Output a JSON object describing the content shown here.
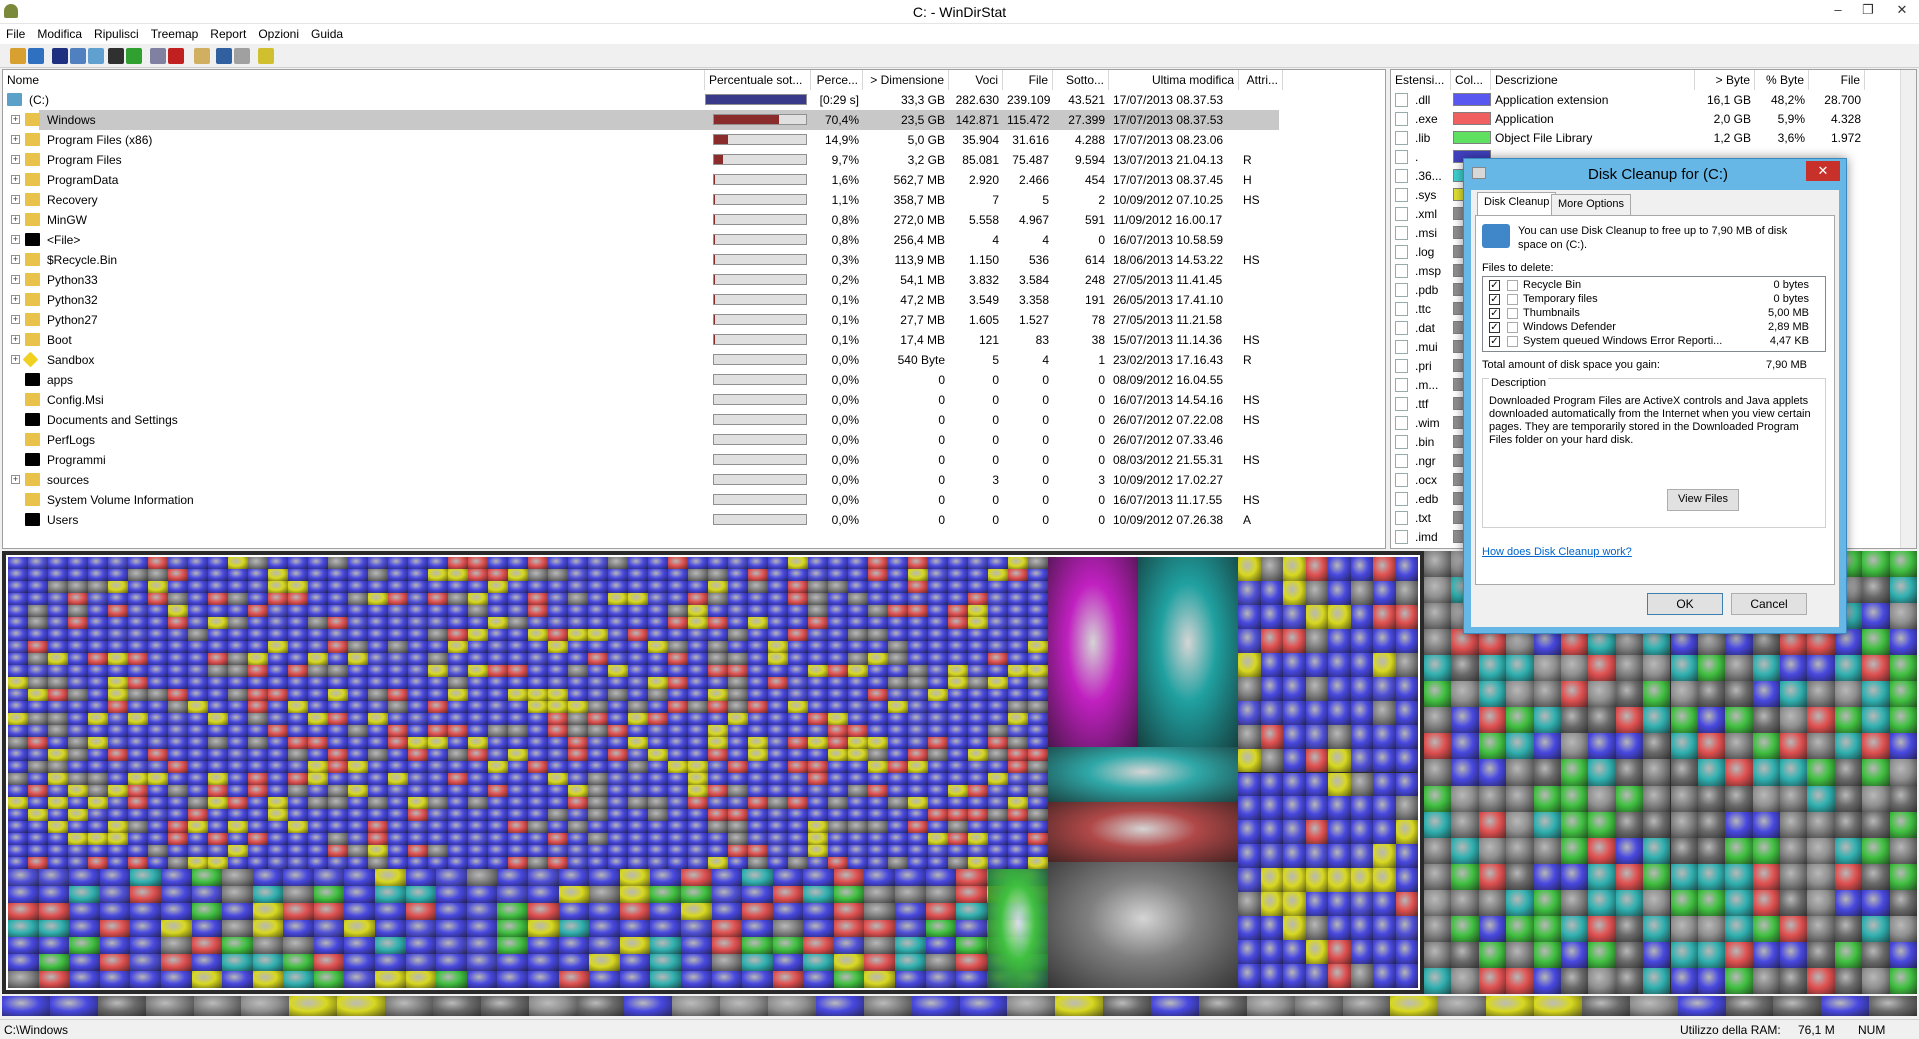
{
  "window": {
    "title": "C: - WinDirStat",
    "controls": {
      "minimize": "–",
      "maximize": "❐",
      "close": "✕"
    }
  },
  "menu": [
    "File",
    "Modifica",
    "Ripulisci",
    "Treemap",
    "Report",
    "Opzioni",
    "Guida"
  ],
  "toolbar": [
    "open-icon",
    "refresh-icon",
    "play-icon",
    "copy-icon",
    "explorer-icon",
    "console-icon",
    "refresh-selected-icon",
    "recycle-icon",
    "delete-icon",
    "new-folder-icon",
    "zoom-in-icon",
    "zoom-out-icon",
    "help-icon"
  ],
  "tree": {
    "headers": [
      "Nome",
      "Percentuale sot...",
      "Perce...",
      "> Dimensione",
      "Voci",
      "File",
      "Sotto...",
      "Ultima modifica",
      "Attri..."
    ],
    "rows": [
      {
        "name": "(C:)",
        "pct": "[0:29 s]",
        "size": "33,3 GB",
        "items": "282.630",
        "files": "239.109",
        "subdirs": "43.521",
        "modified": "17/07/2013 08.37.53",
        "attr": "",
        "fill": 100,
        "type": "drive"
      },
      {
        "name": "Windows",
        "pct": "70,4%",
        "size": "23,5 GB",
        "items": "142.871",
        "files": "115.472",
        "subdirs": "27.399",
        "modified": "17/07/2013 08.37.53",
        "attr": "",
        "fill": 70.4,
        "type": "folder",
        "sel": true
      },
      {
        "name": "Program Files (x86)",
        "pct": "14,9%",
        "size": "5,0 GB",
        "items": "35.904",
        "files": "31.616",
        "subdirs": "4.288",
        "modified": "17/07/2013 08.23.06",
        "attr": "",
        "fill": 14.9,
        "type": "folder"
      },
      {
        "name": "Program Files",
        "pct": "9,7%",
        "size": "3,2 GB",
        "items": "85.081",
        "files": "75.487",
        "subdirs": "9.594",
        "modified": "13/07/2013 21.04.13",
        "attr": "R",
        "fill": 9.7,
        "type": "folder"
      },
      {
        "name": "ProgramData",
        "pct": "1,6%",
        "size": "562,7 MB",
        "items": "2.920",
        "files": "2.466",
        "subdirs": "454",
        "modified": "17/07/2013 08.37.45",
        "attr": "H",
        "fill": 1.6,
        "type": "folder"
      },
      {
        "name": "Recovery",
        "pct": "1,1%",
        "size": "358,7 MB",
        "items": "7",
        "files": "5",
        "subdirs": "2",
        "modified": "10/09/2012 07.10.25",
        "attr": "HS",
        "fill": 1.1,
        "type": "folder"
      },
      {
        "name": "MinGW",
        "pct": "0,8%",
        "size": "272,0 MB",
        "items": "5.558",
        "files": "4.967",
        "subdirs": "591",
        "modified": "11/09/2012 16.00.17",
        "attr": "",
        "fill": 0.8,
        "type": "folder"
      },
      {
        "name": "<File>",
        "pct": "0,8%",
        "size": "256,4 MB",
        "items": "4",
        "files": "4",
        "subdirs": "0",
        "modified": "16/07/2013 10.58.59",
        "attr": "",
        "fill": 0.8,
        "type": "black"
      },
      {
        "name": "$Recycle.Bin",
        "pct": "0,3%",
        "size": "113,9 MB",
        "items": "1.150",
        "files": "536",
        "subdirs": "614",
        "modified": "18/06/2013 14.53.22",
        "attr": "HS",
        "fill": 0.3,
        "type": "folder"
      },
      {
        "name": "Python33",
        "pct": "0,2%",
        "size": "54,1 MB",
        "items": "3.832",
        "files": "3.584",
        "subdirs": "248",
        "modified": "27/05/2013 11.41.45",
        "attr": "",
        "fill": 0.2,
        "type": "folder"
      },
      {
        "name": "Python32",
        "pct": "0,1%",
        "size": "47,2 MB",
        "items": "3.549",
        "files": "3.358",
        "subdirs": "191",
        "modified": "26/05/2013 17.41.10",
        "attr": "",
        "fill": 0.1,
        "type": "folder"
      },
      {
        "name": "Python27",
        "pct": "0,1%",
        "size": "27,7 MB",
        "items": "1.605",
        "files": "1.527",
        "subdirs": "78",
        "modified": "27/05/2013 11.21.58",
        "attr": "",
        "fill": 0.1,
        "type": "folder"
      },
      {
        "name": "Boot",
        "pct": "0,1%",
        "size": "17,4 MB",
        "items": "121",
        "files": "83",
        "subdirs": "38",
        "modified": "15/07/2013 11.14.36",
        "attr": "HS",
        "fill": 0.1,
        "type": "folder"
      },
      {
        "name": "Sandbox",
        "pct": "0,0%",
        "size": "540 Byte",
        "items": "5",
        "files": "4",
        "subdirs": "1",
        "modified": "23/02/2013 17.16.43",
        "attr": "R",
        "fill": 0,
        "type": "sandbox"
      },
      {
        "name": "apps",
        "pct": "0,0%",
        "size": "0",
        "items": "0",
        "files": "0",
        "subdirs": "0",
        "modified": "08/09/2012 16.04.55",
        "attr": "",
        "fill": 0,
        "type": "black"
      },
      {
        "name": "Config.Msi",
        "pct": "0,0%",
        "size": "0",
        "items": "0",
        "files": "0",
        "subdirs": "0",
        "modified": "16/07/2013 14.54.16",
        "attr": "HS",
        "fill": 0,
        "type": "folder"
      },
      {
        "name": "Documents and Settings",
        "pct": "0,0%",
        "size": "0",
        "items": "0",
        "files": "0",
        "subdirs": "0",
        "modified": "26/07/2012 07.22.08",
        "attr": "HS",
        "fill": 0,
        "type": "black"
      },
      {
        "name": "PerfLogs",
        "pct": "0,0%",
        "size": "0",
        "items": "0",
        "files": "0",
        "subdirs": "0",
        "modified": "26/07/2012 07.33.46",
        "attr": "",
        "fill": 0,
        "type": "folder"
      },
      {
        "name": "Programmi",
        "pct": "0,0%",
        "size": "0",
        "items": "0",
        "files": "0",
        "subdirs": "0",
        "modified": "08/03/2012 21.55.31",
        "attr": "HS",
        "fill": 0,
        "type": "black"
      },
      {
        "name": "sources",
        "pct": "0,0%",
        "size": "0",
        "items": "3",
        "files": "0",
        "subdirs": "3",
        "modified": "10/09/2012 17.02.27",
        "attr": "",
        "fill": 0,
        "type": "folder"
      },
      {
        "name": "System Volume Information",
        "pct": "0,0%",
        "size": "0",
        "items": "0",
        "files": "0",
        "subdirs": "0",
        "modified": "16/07/2013 11.17.55",
        "attr": "HS",
        "fill": 0,
        "type": "folder"
      },
      {
        "name": "Users",
        "pct": "0,0%",
        "size": "0",
        "items": "0",
        "files": "0",
        "subdirs": "0",
        "modified": "10/09/2012 07.26.38",
        "attr": "A",
        "fill": 0,
        "type": "black"
      }
    ]
  },
  "extensions": {
    "headers": [
      "Estensi...",
      "Col...",
      "Descrizione",
      "> Byte",
      "% Byte",
      "File"
    ],
    "rows": [
      {
        "ext": ".dll",
        "color": "#5858f0",
        "desc": "Application extension",
        "bytes": "16,1 GB",
        "pct": "48,2%",
        "files": "28.700"
      },
      {
        "ext": ".exe",
        "color": "#f06060",
        "desc": "Application",
        "bytes": "2,0 GB",
        "pct": "5,9%",
        "files": "4.328"
      },
      {
        "ext": ".lib",
        "color": "#60e060",
        "desc": "Object File Library",
        "bytes": "1,2 GB",
        "pct": "3,6%",
        "files": "1.972"
      },
      {
        "ext": ".",
        "color": "#4040c0",
        "desc": "",
        "bytes": "",
        "pct": "",
        "files": ""
      },
      {
        "ext": ".36...",
        "color": "#40d0d0",
        "desc": "",
        "bytes": "",
        "pct": "",
        "files": ""
      },
      {
        "ext": ".sys",
        "color": "#e0e030",
        "desc": "",
        "bytes": "",
        "pct": "",
        "files": ""
      },
      {
        "ext": ".xml",
        "color": "#909090",
        "desc": "",
        "bytes": "",
        "pct": "",
        "files": ""
      },
      {
        "ext": ".msi",
        "color": "#909090",
        "desc": "",
        "bytes": "",
        "pct": "",
        "files": ""
      },
      {
        "ext": ".log",
        "color": "#909090",
        "desc": "",
        "bytes": "",
        "pct": "",
        "files": ""
      },
      {
        "ext": ".msp",
        "color": "#909090",
        "desc": "",
        "bytes": "",
        "pct": "",
        "files": ""
      },
      {
        "ext": ".pdb",
        "color": "#909090",
        "desc": "",
        "bytes": "",
        "pct": "",
        "files": ""
      },
      {
        "ext": ".ttc",
        "color": "#909090",
        "desc": "",
        "bytes": "",
        "pct": "",
        "files": ""
      },
      {
        "ext": ".dat",
        "color": "#909090",
        "desc": "",
        "bytes": "",
        "pct": "",
        "files": ""
      },
      {
        "ext": ".mui",
        "color": "#909090",
        "desc": "",
        "bytes": "",
        "pct": "",
        "files": ""
      },
      {
        "ext": ".pri",
        "color": "#909090",
        "desc": "",
        "bytes": "",
        "pct": "",
        "files": ""
      },
      {
        "ext": ".m...",
        "color": "#909090",
        "desc": "",
        "bytes": "",
        "pct": "",
        "files": ""
      },
      {
        "ext": ".ttf",
        "color": "#909090",
        "desc": "",
        "bytes": "",
        "pct": "",
        "files": ""
      },
      {
        "ext": ".wim",
        "color": "#909090",
        "desc": "",
        "bytes": "",
        "pct": "",
        "files": ""
      },
      {
        "ext": ".bin",
        "color": "#909090",
        "desc": "",
        "bytes": "",
        "pct": "",
        "files": ""
      },
      {
        "ext": ".ngr",
        "color": "#909090",
        "desc": "",
        "bytes": "",
        "pct": "",
        "files": ""
      },
      {
        "ext": ".ocx",
        "color": "#909090",
        "desc": "",
        "bytes": "",
        "pct": "",
        "files": ""
      },
      {
        "ext": ".edb",
        "color": "#909090",
        "desc": "",
        "bytes": "",
        "pct": "",
        "files": ""
      },
      {
        "ext": ".txt",
        "color": "#909090",
        "desc": "",
        "bytes": "",
        "pct": "",
        "files": ""
      },
      {
        "ext": ".imd",
        "color": "#909090",
        "desc": "",
        "bytes": "",
        "pct": "",
        "files": ""
      }
    ]
  },
  "dialog": {
    "title": "Disk Cleanup for  (C:)",
    "tabs": [
      "Disk Cleanup",
      "More Options"
    ],
    "intro": "You can use Disk Cleanup to free up to 7,90 MB of disk space on  (C:).",
    "files_label": "Files to delete:",
    "items": [
      {
        "name": "Recycle Bin",
        "size": "0 bytes",
        "checked": true
      },
      {
        "name": "Temporary files",
        "size": "0 bytes",
        "checked": true
      },
      {
        "name": "Thumbnails",
        "size": "5,00 MB",
        "checked": true
      },
      {
        "name": "Windows Defender",
        "size": "2,89 MB",
        "checked": true
      },
      {
        "name": "System queued Windows Error Reporti...",
        "size": "4,47 KB",
        "checked": true
      }
    ],
    "total_label": "Total amount of disk space you gain:",
    "total_value": "7,90 MB",
    "desc_label": "Description",
    "description": "Downloaded Program Files are ActiveX controls and Java applets downloaded automatically from the Internet when you view certain pages. They are temporarily stored in the Downloaded Program Files folder on your hard disk.",
    "view_files": "View Files",
    "help_link": "How does Disk Cleanup work?",
    "ok": "OK",
    "cancel": "Cancel"
  },
  "status": {
    "path": "C:\\Windows",
    "ram_label": "Utilizzo della RAM:",
    "ram_value": "76,1 M",
    "num": "NUM"
  },
  "colors": {
    "selected_bar": "#8b2c2c",
    "drive_bar": "#3a3a8a",
    "accent": "#66b7e6"
  }
}
